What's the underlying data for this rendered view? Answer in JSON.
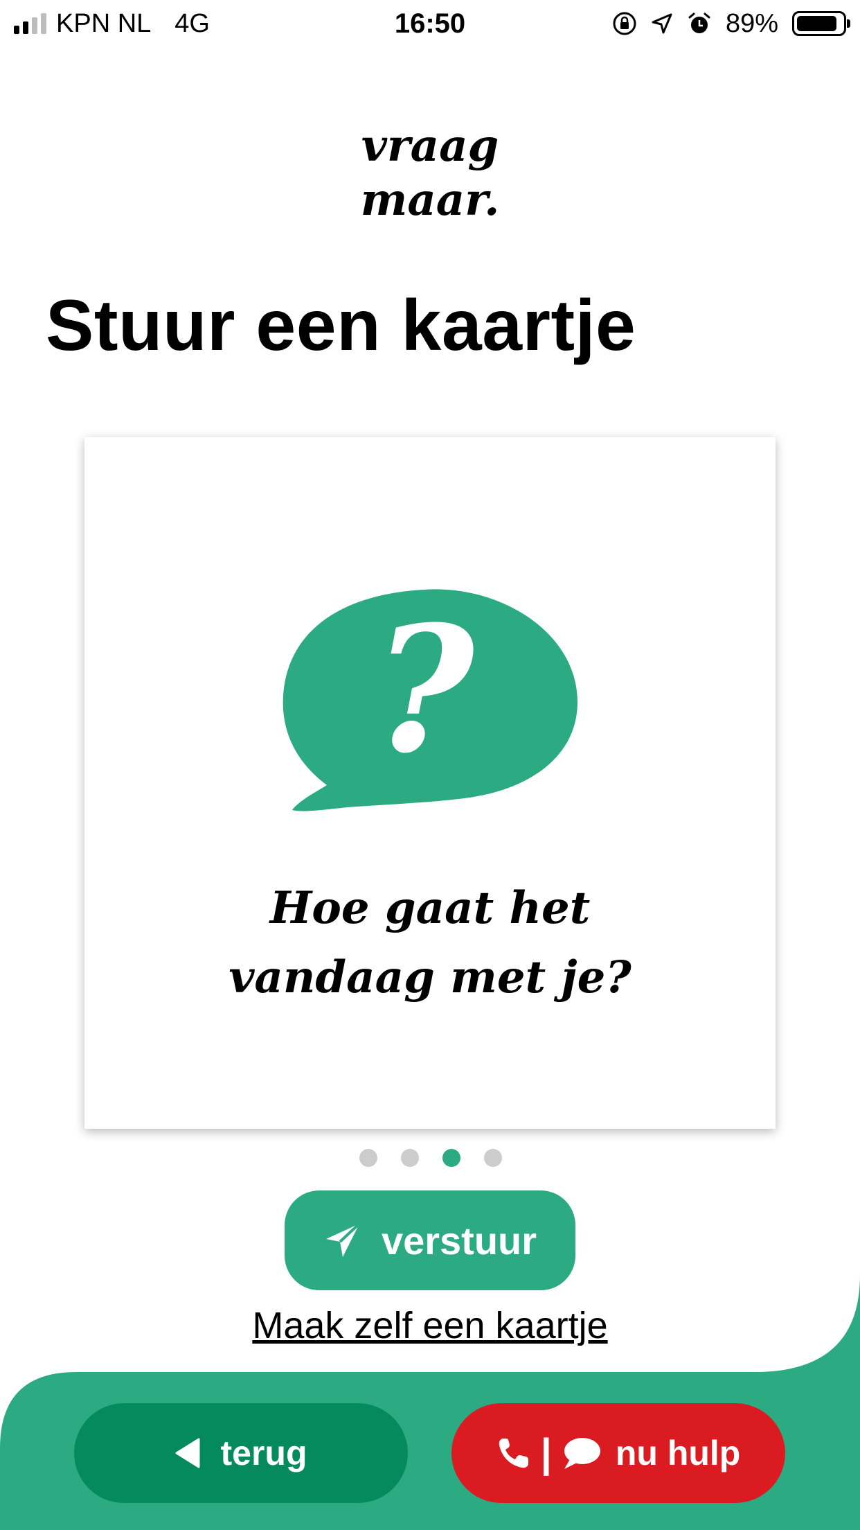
{
  "status_bar": {
    "carrier": "KPN NL",
    "network": "4G",
    "time": "16:50",
    "battery_percent": "89%",
    "icons": [
      "signal-icon",
      "orientation-lock-icon",
      "location-arrow-icon",
      "alarm-icon",
      "battery-icon"
    ]
  },
  "logo": {
    "line1": "vraag",
    "line2": "maar."
  },
  "page": {
    "title": "Stuur een kaartje"
  },
  "card": {
    "icon": "question-speech-bubble",
    "message_line1": "Hoe gaat het",
    "message_line2": "vandaag met je?"
  },
  "carousel": {
    "total": 4,
    "active_index": 2
  },
  "actions": {
    "send_label": "verstuur",
    "make_own_label": "Maak zelf een kaartje"
  },
  "bottom_bar": {
    "back_label": "terug",
    "help_separator": "|",
    "help_label": "nu hulp"
  },
  "colors": {
    "brand_green": "#2caa82",
    "dark_green": "#058a5d",
    "alert_red": "#db1b22"
  }
}
